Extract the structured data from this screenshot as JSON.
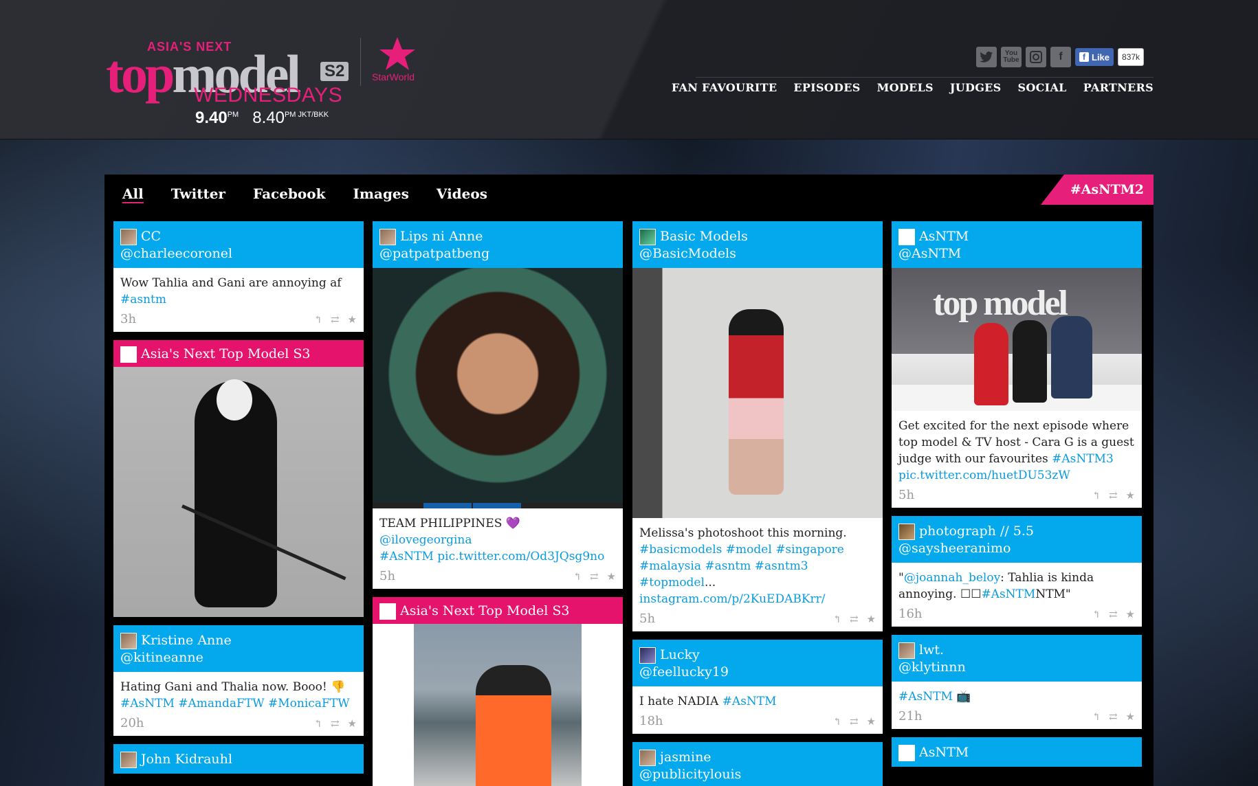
{
  "header": {
    "logo": {
      "top_text": "ASIA'S NEXT",
      "main_text_pink": "top",
      "main_text_grey": "model",
      "series": "S2",
      "day": "WEDNESDAYS",
      "time1": "9.40",
      "time1_suffix": "PM",
      "time2": "8.40",
      "time2_suffix": "PM JKT/BKK"
    },
    "channel": "StarWorld",
    "social": {
      "icons": [
        "twitter-icon",
        "youtube-icon",
        "instagram-icon",
        "facebook-icon"
      ],
      "youtube_text": "You Tube",
      "like_label": "Like",
      "like_count": "837k"
    },
    "nav": [
      "FAN FAVOURITE",
      "EPISODES",
      "MODELS",
      "JUDGES",
      "SOCIAL",
      "PARTNERS"
    ]
  },
  "stream": {
    "filters": [
      "All",
      "Twitter",
      "Facebook",
      "Images",
      "Videos"
    ],
    "active_filter": "All",
    "hashtag": "#AsNTM2"
  },
  "columns": [
    {
      "cards": [
        {
          "name": "CC",
          "handle": "@charleecoronel",
          "text": "Wow Tahlia and Gani are annoying af",
          "tags": "#asntm",
          "time": "3h"
        },
        {
          "name": "Asia's Next Top Model S3",
          "source": "facebook"
        },
        {
          "name": "Kristine Anne",
          "handle": "@kitineanne",
          "text": "Hating Gani and Thalia now. Booo! 👎",
          "tags": "#AsNTM #AmandaFTW #MonicaFTW",
          "time": "20h"
        },
        {
          "name": "John Kidrauhl"
        }
      ]
    },
    {
      "cards": [
        {
          "name": "Lips ni Anne",
          "handle": "@patpatpatbeng",
          "text": "TEAM PHILIPPINES 💜 ",
          "mention": "@ilovegeorgina",
          "tags": "#AsNTM pic.twitter.com/Od3JQsg9no",
          "time": "5h"
        },
        {
          "name": "Asia's Next Top Model S3",
          "source": "facebook"
        }
      ]
    },
    {
      "cards": [
        {
          "name": "Basic Models",
          "handle": "@BasicModels",
          "text": "Melissa's photoshoot this morning.",
          "tags": "#basicmodels #model #singapore #malaysia #asntm #asntm3 #topmodel",
          "ellipsis": "...",
          "link": "instagram.com/p/2KuEDABKrr/",
          "time": "5h"
        },
        {
          "name": "Lucky",
          "handle": "@feellucky19",
          "text": "I hate NADIA ",
          "tags": "#AsNTM",
          "time": "18h"
        },
        {
          "name": "jasmine",
          "handle": "@publicitylouis"
        }
      ]
    },
    {
      "cards": [
        {
          "name": "AsNTM",
          "handle": "@AsNTM",
          "photo_title": "top model",
          "text": "Get excited for the next episode where top model & TV host - Cara G is a guest judge with our favourites ",
          "tags": "#AsNTM3",
          "link": "pic.twitter.com/huetDU53zW",
          "time": "5h"
        },
        {
          "name": "photograph // 5.5",
          "handle": "@saysheeranimo",
          "quote_open": "\"",
          "mention": "@joannah_beloy",
          "text": ": Tahlia is kinda annoying. ☐☐",
          "tags": "#AsNTM",
          "after": "NTM\"",
          "time": "16h"
        },
        {
          "name": "lwt.",
          "handle": "@klytinnn",
          "tags": "#AsNTM",
          "emoji": "📺",
          "time": "21h"
        },
        {
          "name": "AsNTM"
        }
      ]
    }
  ],
  "actions": {
    "reply": "↰",
    "retweet": "⇄",
    "favorite": "★"
  },
  "colors": {
    "tweet_header": "#03a9ec",
    "facebook_header": "#e6136c",
    "brand_pink": "#e6207a",
    "link": "#0a9be0"
  }
}
